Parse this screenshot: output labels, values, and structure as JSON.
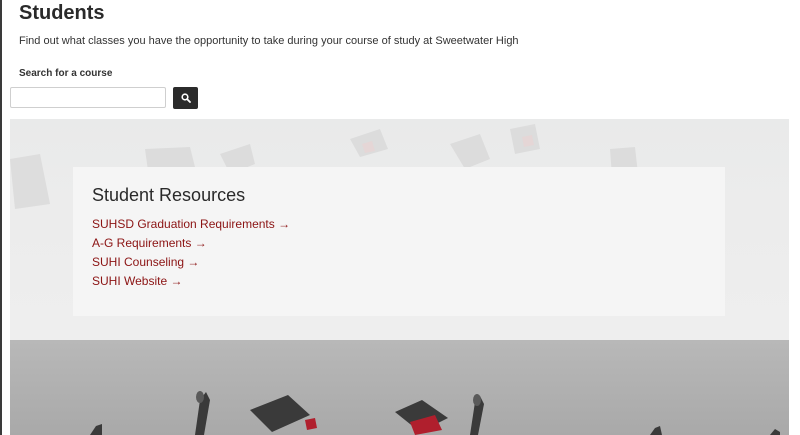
{
  "page": {
    "title": "Students",
    "subtitle": "Find out what classes you have the opportunity to take during your course of study at Sweetwater High"
  },
  "search": {
    "label": "Search for a course",
    "value": "",
    "placeholder": "",
    "button_icon": "search-icon"
  },
  "resources": {
    "title": "Student Resources",
    "links": [
      "SUHSD Graduation Requirements →",
      "A-G Requirements →",
      "SUHI Counseling →",
      "SUHI Website →"
    ]
  },
  "colors": {
    "link": "#8b1313",
    "button": "#2b2b2b",
    "hero_bg": "#ececec",
    "card_bg": "#f5f5f5"
  }
}
